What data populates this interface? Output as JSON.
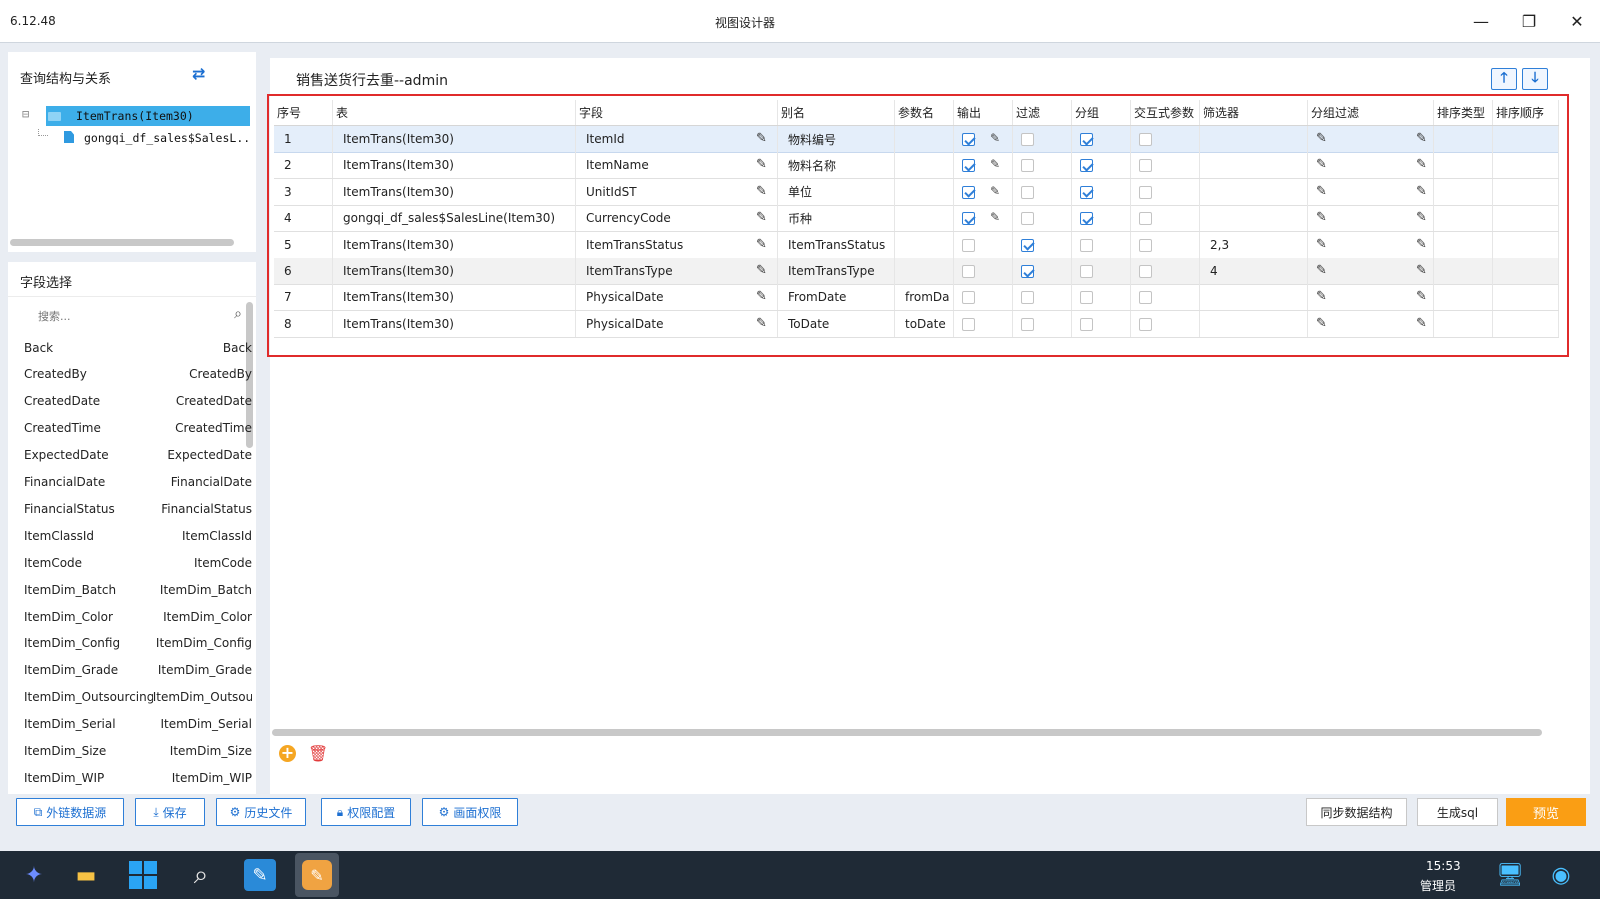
{
  "window": {
    "version": "6.12.48",
    "title": "视图设计器",
    "minimize": "—",
    "restore": "❐",
    "close": "✕"
  },
  "query_panel": {
    "title": "查询结构与关系",
    "swap_icon": "⇄",
    "tree": [
      {
        "toggle": "⊟",
        "label": "ItemTrans(Item30)"
      },
      {
        "label": "gongqi_df_sales$SalesL..."
      }
    ]
  },
  "field_panel": {
    "title": "字段选择",
    "search_placeholder": "搜索...",
    "fields": [
      {
        "name": "Back",
        "alias": "Back"
      },
      {
        "name": "CreatedBy",
        "alias": "CreatedBy"
      },
      {
        "name": "CreatedDate",
        "alias": "CreatedDate"
      },
      {
        "name": "CreatedTime",
        "alias": "CreatedTime"
      },
      {
        "name": "ExpectedDate",
        "alias": "ExpectedDate"
      },
      {
        "name": "FinancialDate",
        "alias": "FinancialDate"
      },
      {
        "name": "FinancialStatus",
        "alias": "FinancialStatus"
      },
      {
        "name": "ItemClassId",
        "alias": "ItemClassId"
      },
      {
        "name": "ItemCode",
        "alias": "ItemCode"
      },
      {
        "name": "ItemDim_Batch",
        "alias": "ItemDim_Batch"
      },
      {
        "name": "ItemDim_Color",
        "alias": "ItemDim_Color"
      },
      {
        "name": "ItemDim_Config",
        "alias": "ItemDim_Config"
      },
      {
        "name": "ItemDim_Grade",
        "alias": "ItemDim_Grade"
      },
      {
        "name": "ItemDim_Outsourcing",
        "alias": "ItemDim_Outsou"
      },
      {
        "name": "ItemDim_Serial",
        "alias": "ItemDim_Serial"
      },
      {
        "name": "ItemDim_Size",
        "alias": "ItemDim_Size"
      },
      {
        "name": "ItemDim_WIP",
        "alias": "ItemDim_WIP"
      }
    ]
  },
  "main": {
    "title": "销售送货行去重--admin",
    "up_icon": "🡑",
    "down_icon": "🡓",
    "columns": [
      "序号",
      "表",
      "字段",
      "别名",
      "参数名",
      "输出",
      "过滤",
      "分组",
      "交互式参数",
      "筛选器",
      "分组过滤",
      "排序类型",
      "排序顺序"
    ],
    "rows": [
      {
        "no": "1",
        "table": "ItemTrans(Item30)",
        "field": "ItemId",
        "alias": "物料编号",
        "param": "",
        "output": true,
        "filter": false,
        "group": true,
        "interactive": false,
        "selector": ""
      },
      {
        "no": "2",
        "table": "ItemTrans(Item30)",
        "field": "ItemName",
        "alias": "物料名称",
        "param": "",
        "output": true,
        "filter": false,
        "group": true,
        "interactive": false,
        "selector": ""
      },
      {
        "no": "3",
        "table": "ItemTrans(Item30)",
        "field": "UnitIdST",
        "alias": "单位",
        "param": "",
        "output": true,
        "filter": false,
        "group": true,
        "interactive": false,
        "selector": ""
      },
      {
        "no": "4",
        "table": "gongqi_df_sales$SalesLine(Item30)",
        "field": "CurrencyCode",
        "alias": "币种",
        "param": "",
        "output": true,
        "filter": false,
        "group": true,
        "interactive": false,
        "selector": ""
      },
      {
        "no": "5",
        "table": "ItemTrans(Item30)",
        "field": "ItemTransStatus",
        "alias": "ItemTransStatus",
        "param": "",
        "output": false,
        "filter": true,
        "group": false,
        "interactive": false,
        "selector": "2,3"
      },
      {
        "no": "6",
        "table": "ItemTrans(Item30)",
        "field": "ItemTransType",
        "alias": "ItemTransType",
        "param": "",
        "output": false,
        "filter": true,
        "group": false,
        "interactive": false,
        "selector": "4"
      },
      {
        "no": "7",
        "table": "ItemTrans(Item30)",
        "field": "PhysicalDate",
        "alias": "FromDate",
        "param": "fromDa",
        "output": false,
        "filter": false,
        "group": false,
        "interactive": false,
        "selector": ""
      },
      {
        "no": "8",
        "table": "ItemTrans(Item30)",
        "field": "PhysicalDate",
        "alias": "ToDate",
        "param": "toDate",
        "output": false,
        "filter": false,
        "group": false,
        "interactive": false,
        "selector": ""
      }
    ],
    "add_icon": "+",
    "delete_icon": "🗑"
  },
  "toolbar": {
    "external_source": "外链数据源",
    "save": "保存",
    "history": "历史文件",
    "permission": "权限配置",
    "screen_permission": "画面权限",
    "sync": "同步数据结构",
    "gen_sql": "生成sql",
    "preview": "预览"
  },
  "taskbar": {
    "time": "15:53",
    "user": "管理员"
  },
  "colors": {
    "accent": "#2f7fd8",
    "highlight_border": "#e02b2b",
    "preview_button": "#fa9e14",
    "taskbar": "#1f2a36"
  }
}
